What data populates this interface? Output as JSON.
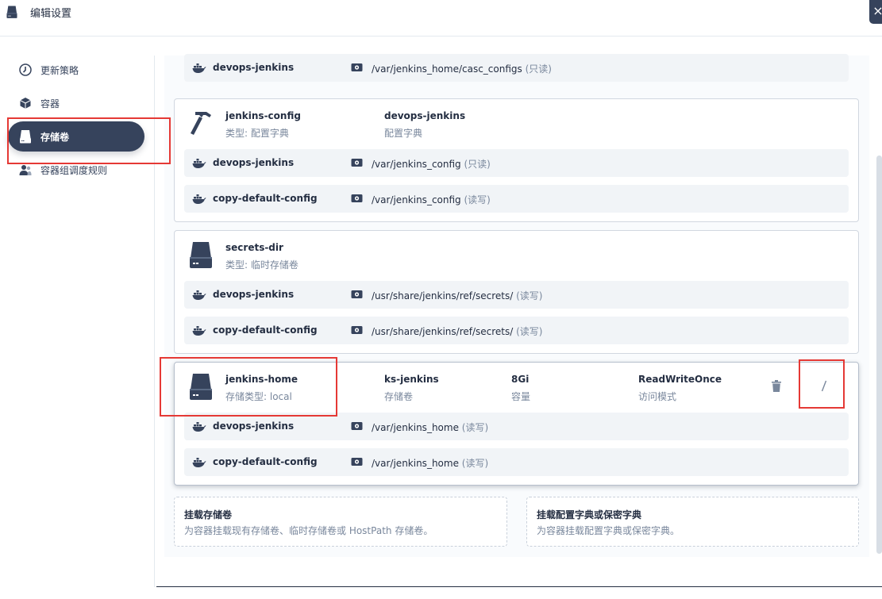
{
  "header": {
    "title": "编辑设置",
    "close_label": "×"
  },
  "sidebar": {
    "items": [
      {
        "label": "更新策略",
        "icon": "update-strategy-icon"
      },
      {
        "label": "容器",
        "icon": "container-icon"
      },
      {
        "label": "存储卷",
        "icon": "volume-icon",
        "active": true
      },
      {
        "label": "容器组调度规则",
        "icon": "pod-scheduling-icon"
      }
    ]
  },
  "top_mount": {
    "container": "devops-jenkins",
    "path": "/var/jenkins_home/casc_configs",
    "mode": "(只读)"
  },
  "volumes": [
    {
      "name": "jenkins-config",
      "sub": "类型: 配置字典",
      "col1": {
        "value": "devops-jenkins",
        "label": "配置字典"
      },
      "mounts": [
        {
          "container": "devops-jenkins",
          "path": "/var/jenkins_config",
          "mode": "(只读)"
        },
        {
          "container": "copy-default-config",
          "path": "/var/jenkins_config",
          "mode": "(读写)"
        }
      ]
    },
    {
      "name": "secrets-dir",
      "sub": "类型: 临时存储卷",
      "mounts": [
        {
          "container": "devops-jenkins",
          "path": "/usr/share/jenkins/ref/secrets/",
          "mode": "(读写)"
        },
        {
          "container": "copy-default-config",
          "path": "/usr/share/jenkins/ref/secrets/",
          "mode": "(读写)"
        }
      ]
    },
    {
      "name": "jenkins-home",
      "sub": "存储类型: local",
      "col1": {
        "value": "ks-jenkins",
        "label": "存储卷"
      },
      "col2": {
        "value": "8Gi",
        "label": "容量"
      },
      "col3": {
        "value": "ReadWriteOnce",
        "label": "访问模式"
      },
      "mounts": [
        {
          "container": "devops-jenkins",
          "path": "/var/jenkins_home",
          "mode": "(读写)"
        },
        {
          "container": "copy-default-config",
          "path": "/var/jenkins_home",
          "mode": "(读写)"
        }
      ]
    }
  ],
  "actions": [
    {
      "title": "挂载存储卷",
      "desc": "为容器挂载现有存储卷、临时存储卷或 HostPath 存储卷。"
    },
    {
      "title": "挂载配置字典或保密字典",
      "desc": "为容器挂载配置字典或保密字典。"
    }
  ],
  "colors": {
    "primary": "#36435c",
    "highlight": "#e53935",
    "muted": "#79879c",
    "row_bg": "#f1f4f7"
  }
}
